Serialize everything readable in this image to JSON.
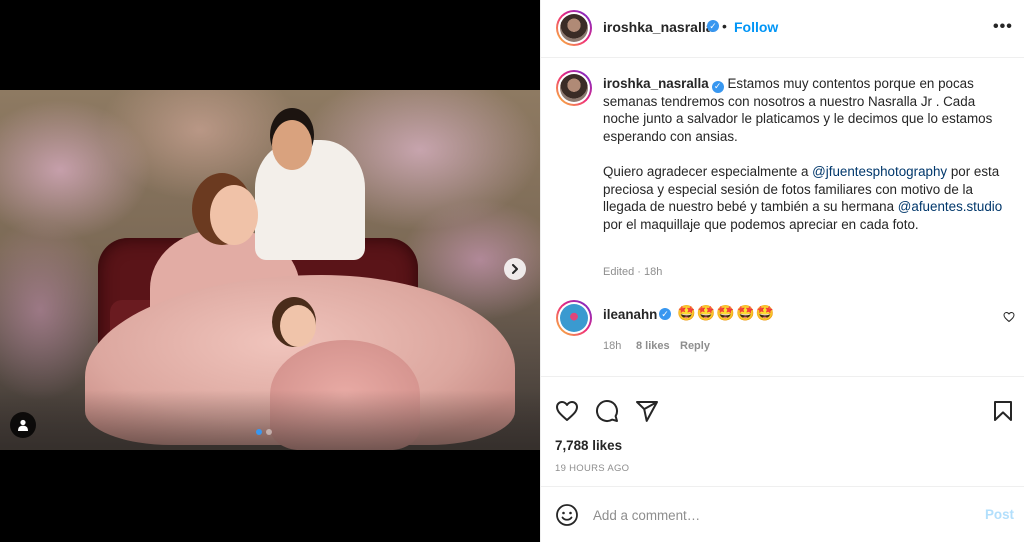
{
  "post": {
    "username": "iroshka_nasralla",
    "dot": "•",
    "follow_label": "Follow",
    "more_label": "•••",
    "media_pages": 2,
    "active_page": 1
  },
  "caption": {
    "username": "iroshka_nasralla",
    "paragraph1": "Estamos muy contentos porque en pocas semanas tendremos con nosotros a nuestro Nasralla Jr . Cada noche junto a salvador le platicamos y le decimos que lo estamos esperando con ansias.",
    "p2_part1": "Quiero agradecer especialmente a ",
    "mention1": "@jfuentesphotography",
    "p2_part2": " por esta preciosa y especial sesión de fotos familiares con motivo de la llegada de nuestro bebé y también a su hermana ",
    "mention2": "@afuentes.studio",
    "p2_part3": " por el maquillaje que podemos apreciar en cada foto.",
    "meta": "Edited · 18h"
  },
  "comment": {
    "username": "ileanahn",
    "text": "🤩🤩🤩🤩🤩",
    "time": "18h",
    "likes": "8 likes",
    "reply_label": "Reply"
  },
  "actions": {
    "likes_count": "7,788 likes",
    "post_time": "19 HOURS AGO"
  },
  "add_comment": {
    "placeholder": "Add a comment…",
    "post_label": "Post"
  },
  "colors": {
    "link_blue": "#0095f6",
    "mention": "#00376b",
    "muted": "#8e8e8e",
    "post_disabled": "#b2dffc"
  }
}
